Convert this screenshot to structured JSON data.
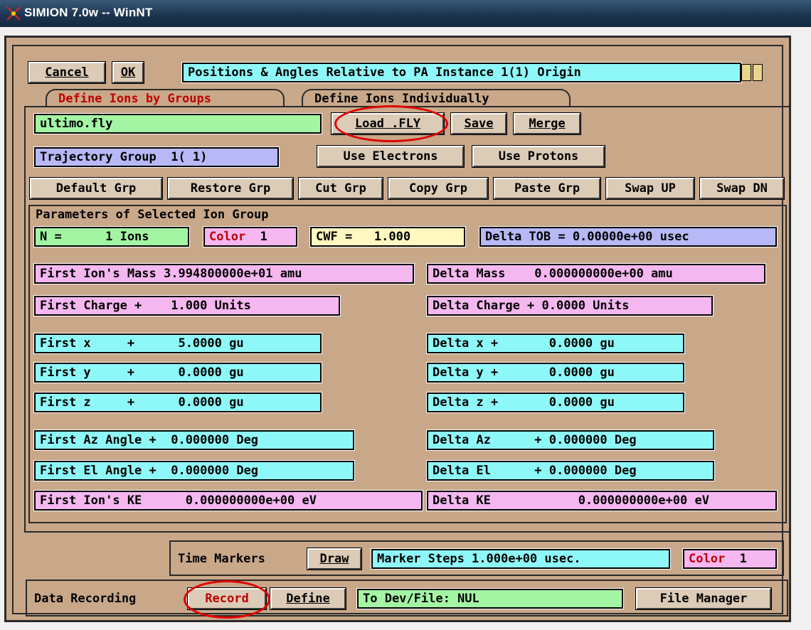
{
  "window": {
    "title": "SIMION 7.0w -- WinNT"
  },
  "toolbar": {
    "cancel": "Cancel",
    "ok": "OK",
    "positions_banner": "Positions & Angles Relative to PA Instance 1(1) Origin"
  },
  "tabs": {
    "groups": "Define Ions by Groups",
    "individually": "Define Ions Individually"
  },
  "file": {
    "name": "ultimo.fly",
    "load": "Load .FLY",
    "save": "Save",
    "merge": "Merge"
  },
  "group_row": {
    "trajectory_group": "Trajectory Group  1( 1)",
    "use_electrons": "Use Electrons",
    "use_protons": "Use Protons"
  },
  "group_buttons": [
    "Default Grp",
    "Restore Grp",
    "Cut Grp",
    "Copy Grp",
    "Paste Grp",
    "Swap UP",
    "Swap DN"
  ],
  "params": {
    "heading": "Parameters of Selected Ion Group",
    "n_ions": "N =      1 Ions",
    "color_label": "Color",
    "color_value": "1",
    "cwf": "CWF =   1.000",
    "delta_tob": "Delta TOB = 0.00000e+00 usec",
    "first_mass": "First Ion's Mass 3.994800000e+01 amu",
    "delta_mass": "Delta Mass    0.000000000e+00 amu",
    "first_charge": "First Charge +    1.000 Units",
    "delta_charge": "Delta Charge + 0.0000 Units",
    "first_x": "First x     +      5.0000 gu",
    "first_y": "First y     +      0.0000 gu",
    "first_z": "First z     +      0.0000 gu",
    "delta_x": "Delta x +       0.0000 gu",
    "delta_y": "Delta y +       0.0000 gu",
    "delta_z": "Delta z +       0.0000 gu",
    "first_az": "First Az Angle +  0.000000 Deg",
    "first_el": "First El Angle +  0.000000 Deg",
    "delta_az": "Delta Az      + 0.000000 Deg",
    "delta_el": "Delta El      + 0.000000 Deg",
    "first_ke": "First Ion's KE      0.000000000e+00 eV",
    "delta_ke": "Delta KE            0.000000000e+00 eV"
  },
  "time_markers": {
    "label": "Time Markers",
    "draw": "Draw",
    "steps": "Marker Steps 1.000e+00 usec.",
    "color_label": "Color",
    "color_value": "1"
  },
  "data_recording": {
    "label": "Data Recording",
    "record": "Record",
    "define": "Define",
    "dev_file": "To Dev/File: NUL",
    "file_manager": "File Manager"
  }
}
